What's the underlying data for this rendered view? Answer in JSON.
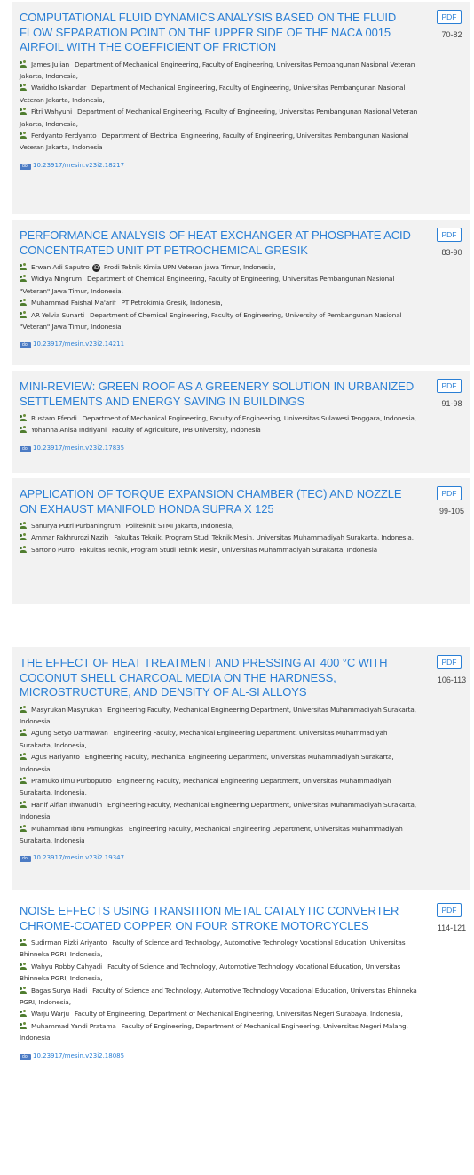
{
  "doi_icon_label": "doi",
  "pdf_label": "PDF",
  "articles": [
    {
      "title": "COMPUTATIONAL FLUID DYNAMICS ANALYSIS BASED ON THE FLUID FLOW SEPARATION POINT ON THE UPPER SIDE OF THE NACA 0015 AIRFOIL WITH THE COEFFICIENT OF FRICTION",
      "pages": "70-82",
      "authors": [
        {
          "name": "James Julian",
          "affiliation": "Department of Mechanical Engineering, Faculty of Engineering, Universitas Pembangunan Nasional Veteran Jakarta, Indonesia,"
        },
        {
          "name": "Waridho Iskandar",
          "affiliation": "Department of Mechanical Engineering, Faculty of Engineering, Universitas Pembangunan Nasional Veteran Jakarta, Indonesia,"
        },
        {
          "name": "Fitri Wahyuni",
          "affiliation": "Department of Mechanical Engineering, Faculty of Engineering, Universitas Pembangunan Nasional Veteran Jakarta, Indonesia,"
        },
        {
          "name": "Ferdyanto Ferdyanto",
          "affiliation": "Department of Electrical Engineering, Faculty of Engineering, Universitas Pembangunan Nasional Veteran Jakarta, Indonesia"
        }
      ],
      "doi": "10.23917/mesin.v23i2.18217"
    },
    {
      "title": "PERFORMANCE ANALYSIS OF HEAT EXCHANGER AT PHOSPHATE ACID CONCENTRATED UNIT PT PETROCHEMICAL GRESIK",
      "pages": "83-90",
      "authors": [
        {
          "name": "Erwan Adi Saputro",
          "orcid": true,
          "affiliation": "Prodi Teknik Kimia UPN Veteran jawa Timur, Indonesia,"
        },
        {
          "name": "Widiya Ningrum",
          "affiliation": "Department of Chemical Engineering, Faculty of Engineering, Universitas Pembangunan Nasional \"Veteran\" Jawa Timur, Indonesia,"
        },
        {
          "name": "Muhammad Faishal Ma'arif",
          "affiliation": "PT Petrokimia Gresik, Indonesia,"
        },
        {
          "name": "AR Yelvia Sunarti",
          "affiliation": "Department of Chemical Engineering, Faculty of Engineering, University of Pembangunan Nasional \"Veteran\" Jawa Timur, Indonesia"
        }
      ],
      "doi": "10.23917/mesin.v23i2.14211"
    },
    {
      "title": "MINI-REVIEW: GREEN ROOF AS A GREENERY SOLUTION IN URBANIZED SETTLEMENTS AND ENERGY SAVING IN BUILDINGS",
      "pages": "91-98",
      "authors": [
        {
          "name": "Rustam Efendi",
          "affiliation": "Department of Mechanical Engineering, Faculty of Engineering, Universitas Sulawesi Tenggara, Indonesia,"
        },
        {
          "name": "Yohanna Anisa Indriyani",
          "affiliation": "Faculty of Agriculture, IPB University, Indonesia"
        }
      ],
      "doi": "10.23917/mesin.v23i2.17835"
    },
    {
      "title": "APPLICATION OF TORQUE EXPANSION CHAMBER (TEC) AND NOZZLE ON EXHAUST MANIFOLD HONDA SUPRA X 125",
      "pages": "99-105",
      "authors": [
        {
          "name": "Sanurya Putri Purbaningrum",
          "affiliation": "Politeknik STMI Jakarta, Indonesia,"
        },
        {
          "name": "Ammar Fakhrurozi Nazih",
          "affiliation": "Fakultas Teknik, Program Studi Teknik Mesin, Universitas Muhammadiyah Surakarta, Indonesia,"
        },
        {
          "name": "Sartono Putro",
          "affiliation": "Fakultas Teknik, Program Studi Teknik Mesin, Universitas Muhammadiyah Surakarta, Indonesia"
        }
      ]
    },
    {
      "title": "THE EFFECT OF HEAT TREATMENT AND PRESSING AT 400 °C WITH COCONUT SHELL CHARCOAL MEDIA ON THE HARDNESS, MICROSTRUCTURE, AND DENSITY OF AL-SI ALLOYS",
      "pages": "106-113",
      "authors": [
        {
          "name": "Masyrukan Masyrukan",
          "affiliation": "Engineering Faculty, Mechanical Engineering Department, Universitas Muhammadiyah Surakarta, Indonesia,"
        },
        {
          "name": "Agung Setyo Darmawan",
          "affiliation": "Engineering Faculty, Mechanical Engineering Department, Universitas Muhammadiyah Surakarta, Indonesia,"
        },
        {
          "name": "Agus Hariyanto",
          "affiliation": "Engineering Faculty, Mechanical Engineering Department, Universitas Muhammadiyah Surakarta, Indonesia,"
        },
        {
          "name": "Pramuko Ilmu Purboputro",
          "affiliation": "Engineering Faculty, Mechanical Engineering Department, Universitas Muhammadiyah Surakarta, Indonesia,"
        },
        {
          "name": "Hanif Alfian Ihwanudin",
          "affiliation": "Engineering Faculty, Mechanical Engineering Department, Universitas Muhammadiyah Surakarta, Indonesia,"
        },
        {
          "name": "Muhammad Ibnu Pamungkas",
          "affiliation": "Engineering Faculty, Mechanical Engineering Department, Universitas Muhammadiyah Surakarta, Indonesia"
        }
      ],
      "doi": "10.23917/mesin.v23i2.19347"
    },
    {
      "title": "NOISE EFFECTS USING TRANSITION METAL CATALYTIC CONVERTER CHROME-COATED COPPER ON FOUR STROKE MOTORCYCLES",
      "pages": "114-121",
      "authors": [
        {
          "name": "Sudirman Rizki Ariyanto",
          "affiliation": "Faculty of Science and Technology, Automotive Technology Vocational Education, Universitas Bhinneka PGRI, Indonesia,"
        },
        {
          "name": "Wahyu Robby Cahyadi",
          "affiliation": "Faculty of Science and Technology, Automotive Technology Vocational Education, Universitas Bhinneka PGRI, Indonesia,"
        },
        {
          "name": "Bagas Surya Hadi",
          "affiliation": "Faculty of Science and Technology, Automotive Technology Vocational Education, Universitas Bhinneka PGRI, Indonesia,"
        },
        {
          "name": "Warju Warju",
          "affiliation": "Faculty of Engineering, Department of Mechanical Engineering, Universitas Negeri Surabaya, Indonesia,"
        },
        {
          "name": "Muhammad Yandi Pratama",
          "affiliation": "Faculty of Engineering, Department of Mechanical Engineering, Universitas Negeri Malang, Indonesia"
        }
      ],
      "doi": "10.23917/mesin.v23i2.18085"
    }
  ]
}
